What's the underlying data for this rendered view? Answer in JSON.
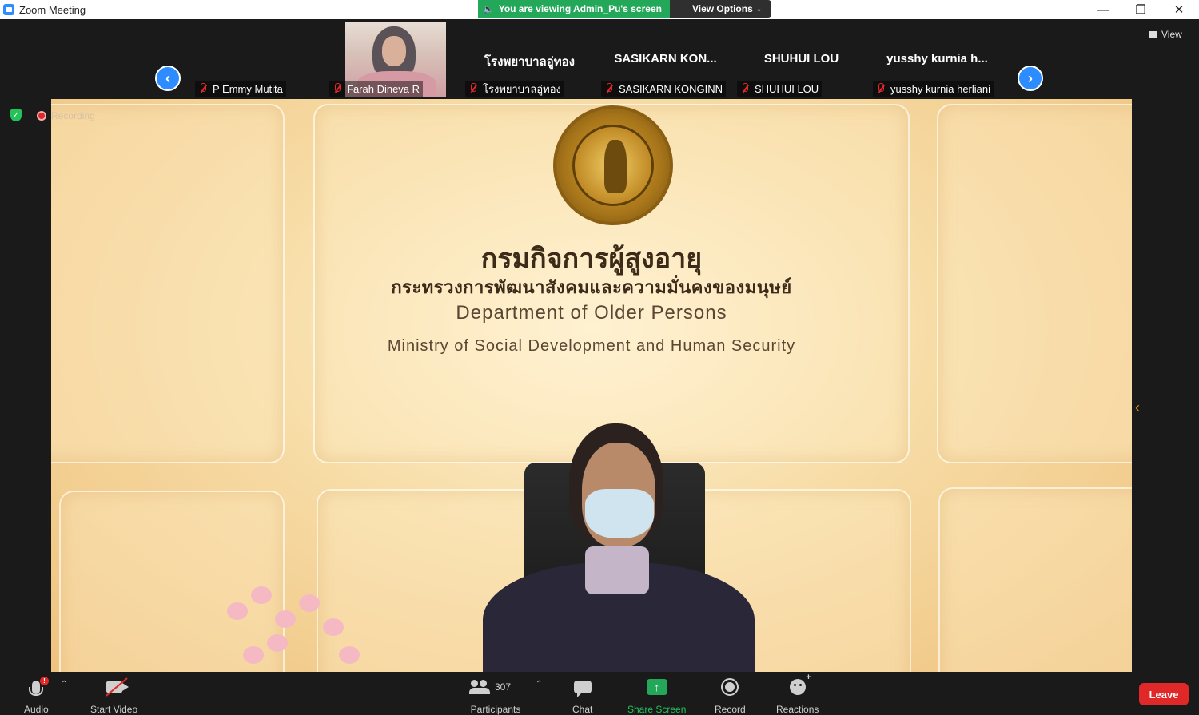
{
  "window": {
    "title": "Zoom Meeting",
    "app_icon": "zoom-icon",
    "controls": {
      "minimize": "—",
      "restore": "❐",
      "close": "✕"
    }
  },
  "banner": {
    "viewing_text": "You are viewing Admin_Pu's screen",
    "view_options_label": "View Options",
    "speaker_icon": "speaker-icon",
    "accent_color": "#23a85a"
  },
  "participants_strip": {
    "prev_label": "‹",
    "next_label": "›",
    "tiles": [
      {
        "display_name": "",
        "name": "P Emmy Mutita",
        "has_video": false
      },
      {
        "display_name": "",
        "name": "Farah Dineva R",
        "has_video": true
      },
      {
        "display_name": "โรงพยาบาลอู่ทอง",
        "name": "โรงพยาบาลอู่ทอง",
        "has_video": false
      },
      {
        "display_name": "SASIKARN  KON...",
        "name": "SASIKARN  KONGINN",
        "has_video": false
      },
      {
        "display_name": "SHUHUI LOU",
        "name": "SHUHUI LOU",
        "has_video": false
      },
      {
        "display_name": "yusshy kurnia h...",
        "name": "yusshy kurnia herliani",
        "has_video": false
      }
    ],
    "view_label": "View"
  },
  "main_video": {
    "recording_label": "Recording",
    "wall_text": {
      "thai_title": "กรมกิจการผู้สูงอายุ",
      "thai_subtitle": "กระทรวงการพัฒนาสังคมและความมั่นคงของมนุษย์",
      "english_title": "Department of Older Persons",
      "english_subtitle": "Ministry of Social Development and Human Security"
    }
  },
  "toolbar": {
    "audio_label": "Audio",
    "audio_badge": "!",
    "video_label": "Start Video",
    "participants_count": "307",
    "participants_label": "Participants",
    "chat_label": "Chat",
    "share_label": "Share Screen",
    "share_icon_glyph": "↑",
    "record_label": "Record",
    "reactions_label": "Reactions",
    "caret": "⌃",
    "leave_label": "Leave",
    "leave_color": "#e02828",
    "share_color": "#23a85a"
  }
}
